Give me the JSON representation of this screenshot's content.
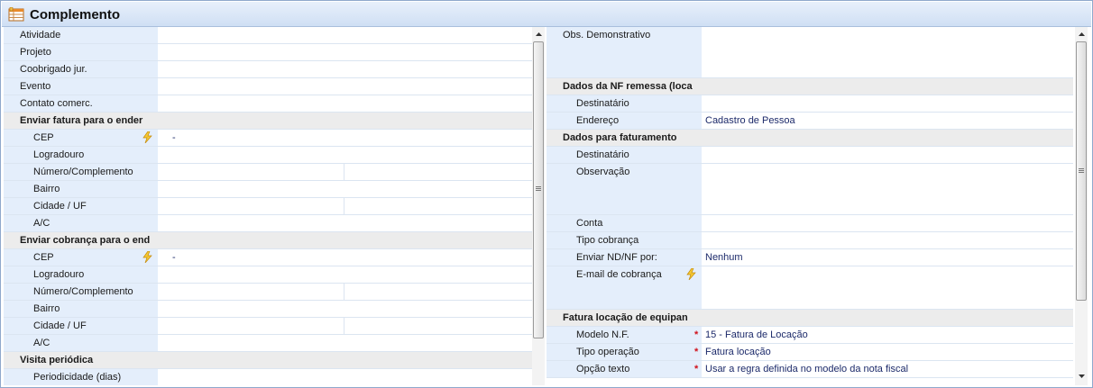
{
  "title": "Complemento",
  "left_rows": [
    {
      "type": "field",
      "label": "Atividade",
      "value": ""
    },
    {
      "type": "field",
      "label": "Projeto",
      "value": ""
    },
    {
      "type": "field",
      "label": "Coobrigado jur.",
      "value": ""
    },
    {
      "type": "field",
      "label": "Evento",
      "value": ""
    },
    {
      "type": "field",
      "label": "Contato comerc.",
      "value": ""
    },
    {
      "type": "section",
      "label": "Enviar fatura para o ender"
    },
    {
      "type": "sub",
      "label": "CEP",
      "value": "-",
      "bolt": true
    },
    {
      "type": "sub",
      "label": "Logradouro",
      "value": ""
    },
    {
      "type": "sub",
      "label": "Número/Complemento",
      "split": true
    },
    {
      "type": "sub",
      "label": "Bairro",
      "value": ""
    },
    {
      "type": "sub",
      "label": "Cidade / UF",
      "split": true
    },
    {
      "type": "sub",
      "label": "A/C",
      "value": ""
    },
    {
      "type": "section",
      "label": "Enviar cobrança para o end"
    },
    {
      "type": "sub",
      "label": "CEP",
      "value": "-",
      "bolt": true
    },
    {
      "type": "sub",
      "label": "Logradouro",
      "value": ""
    },
    {
      "type": "sub",
      "label": "Número/Complemento",
      "split": true
    },
    {
      "type": "sub",
      "label": "Bairro",
      "value": ""
    },
    {
      "type": "sub",
      "label": "Cidade / UF",
      "split": true
    },
    {
      "type": "sub",
      "label": "A/C",
      "value": ""
    },
    {
      "type": "section",
      "label": "Visita periódica"
    },
    {
      "type": "sub",
      "label": "Periodicidade (dias)",
      "value": ""
    }
  ],
  "right_rows": [
    {
      "type": "field",
      "label": "Obs. Demonstrativo",
      "value": "",
      "tall": 3
    },
    {
      "type": "section",
      "label": "Dados da NF remessa (loca"
    },
    {
      "type": "sub",
      "label": "Destinatário",
      "value": ""
    },
    {
      "type": "sub",
      "label": "Endereço",
      "value": "Cadastro de Pessoa"
    },
    {
      "type": "section",
      "label": "Dados para faturamento"
    },
    {
      "type": "sub",
      "label": "Destinatário",
      "value": ""
    },
    {
      "type": "sub",
      "label": "Observação",
      "value": "",
      "tall": 3
    },
    {
      "type": "sub",
      "label": "Conta",
      "value": ""
    },
    {
      "type": "sub",
      "label": "Tipo cobrança",
      "value": ""
    },
    {
      "type": "sub",
      "label": "Enviar ND/NF por:",
      "value": "Nenhum"
    },
    {
      "type": "sub",
      "label": "E-mail de cobrança",
      "value": "",
      "bolt": true,
      "tall": 2.5
    },
    {
      "type": "section",
      "label": "Fatura locação de equipan"
    },
    {
      "type": "sub",
      "label": "Modelo N.F.",
      "value": "15 - Fatura de Locação",
      "required": true
    },
    {
      "type": "sub",
      "label": "Tipo operação",
      "value": "Fatura locação",
      "required": true
    },
    {
      "type": "sub",
      "label": "Opção texto",
      "value": "Usar a regra definida no modelo da nota fiscal",
      "required": true
    }
  ],
  "icons": {
    "title": "form-table-icon",
    "bolt": "lightning-bolt-icon",
    "scroll_up": "arrow-up-icon",
    "scroll_down": "arrow-down-icon"
  },
  "colors": {
    "label_bg": "#e4eefb",
    "section_bg": "#ececec",
    "required": "#d0101a",
    "value_text": "#1c2a6a"
  }
}
